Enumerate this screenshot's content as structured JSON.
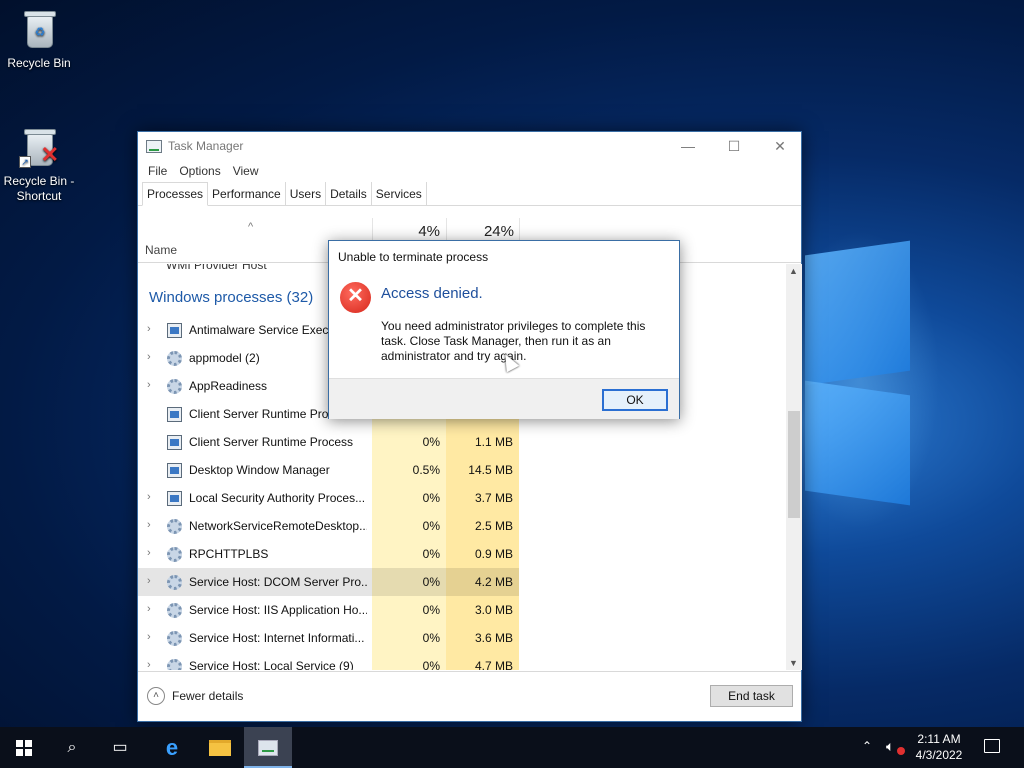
{
  "desktop": {
    "icons": [
      {
        "label": "Recycle Bin"
      },
      {
        "label": "Recycle Bin -\nShortcut"
      }
    ]
  },
  "task_manager": {
    "title": "Task Manager",
    "menu": [
      "File",
      "Options",
      "View"
    ],
    "tabs": [
      "Processes",
      "Performance",
      "Users",
      "Details",
      "Services"
    ],
    "active_tab": "Processes",
    "columns": {
      "name": "Name",
      "cpu_total": "4%",
      "memory_total": "24%"
    },
    "partial_row": "WMI Provider Host",
    "group_label": "Windows processes (32)",
    "rows": [
      {
        "name": "Antimalware Service Executable",
        "cpu": "",
        "mem": "",
        "expandable": true,
        "icon": "window"
      },
      {
        "name": "appmodel (2)",
        "cpu": "",
        "mem": "",
        "expandable": true,
        "icon": "gear"
      },
      {
        "name": "AppReadiness",
        "cpu": "",
        "mem": "",
        "expandable": true,
        "icon": "gear"
      },
      {
        "name": "Client Server Runtime Process",
        "cpu": "",
        "mem": "",
        "expandable": false,
        "icon": "window"
      },
      {
        "name": "Client Server Runtime Process",
        "cpu": "0%",
        "mem": "1.1 MB",
        "expandable": false,
        "icon": "window"
      },
      {
        "name": "Desktop Window Manager",
        "cpu": "0.5%",
        "mem": "14.5 MB",
        "expandable": false,
        "icon": "window"
      },
      {
        "name": "Local Security Authority Proces...",
        "cpu": "0%",
        "mem": "3.7 MB",
        "expandable": true,
        "icon": "window"
      },
      {
        "name": "NetworkServiceRemoteDesktop...",
        "cpu": "0%",
        "mem": "2.5 MB",
        "expandable": true,
        "icon": "gear"
      },
      {
        "name": "RPCHTTPLBS",
        "cpu": "0%",
        "mem": "0.9 MB",
        "expandable": true,
        "icon": "gear"
      },
      {
        "name": "Service Host: DCOM Server Pro...",
        "cpu": "0%",
        "mem": "4.2 MB",
        "expandable": true,
        "icon": "gear",
        "highlighted": true
      },
      {
        "name": "Service Host: IIS Application Ho...",
        "cpu": "0%",
        "mem": "3.0 MB",
        "expandable": true,
        "icon": "gear"
      },
      {
        "name": "Service Host: Internet Informati...",
        "cpu": "0%",
        "mem": "3.6 MB",
        "expandable": true,
        "icon": "gear"
      },
      {
        "name": "Service Host: Local Service (9)",
        "cpu": "0%",
        "mem": "4.7 MB",
        "expandable": true,
        "icon": "gear"
      }
    ],
    "footer": {
      "fewer_details": "Fewer details",
      "end_task": "End task"
    }
  },
  "dialog": {
    "title": "Unable to terminate process",
    "heading": "Access denied.",
    "message": "You need administrator privileges to complete this task. Close Task Manager, then run it as an administrator and try again.",
    "ok": "OK"
  },
  "taskbar": {
    "time": "2:11 AM",
    "date": "4/3/2022"
  },
  "colors": {
    "accent": "#1e5aa8",
    "cpu_column": "#fff4c4",
    "memory_column": "#ffe9a3",
    "error_red": "#d6271b"
  }
}
